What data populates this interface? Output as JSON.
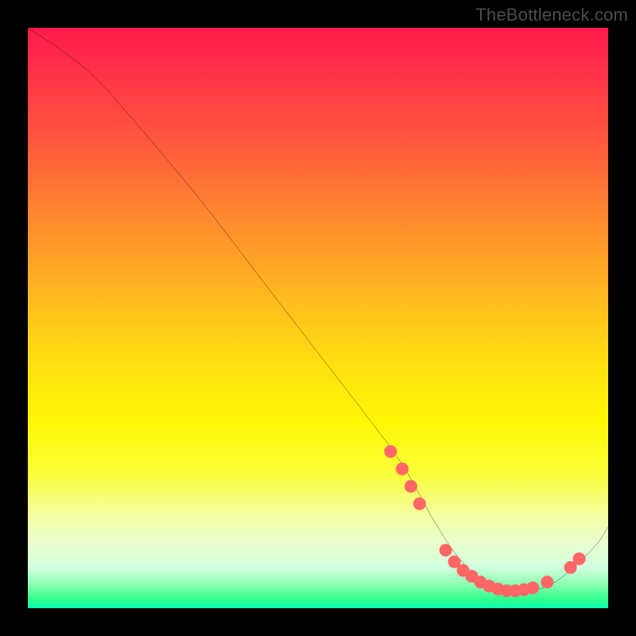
{
  "watermark": "TheBottleneck.com",
  "chart_data": {
    "type": "line",
    "title": "",
    "xlabel": "",
    "ylabel": "",
    "xlim": [
      0,
      100
    ],
    "ylim": [
      0,
      100
    ],
    "series": [
      {
        "name": "curve",
        "x": [
          0,
          6,
          12,
          20,
          30,
          40,
          50,
          60,
          65,
          70,
          74,
          78,
          82,
          86,
          90,
          94,
          98,
          100
        ],
        "y": [
          100,
          96,
          91,
          82,
          70,
          57,
          44,
          31,
          24,
          15,
          9,
          5,
          3,
          3,
          4,
          7,
          11,
          14
        ],
        "color": "#000000"
      }
    ],
    "markers": [
      {
        "x": 62.5,
        "y": 27
      },
      {
        "x": 64.5,
        "y": 24
      },
      {
        "x": 66.0,
        "y": 21
      },
      {
        "x": 67.5,
        "y": 18
      },
      {
        "x": 72.0,
        "y": 10
      },
      {
        "x": 73.5,
        "y": 8
      },
      {
        "x": 75.0,
        "y": 6.5
      },
      {
        "x": 76.5,
        "y": 5.5
      },
      {
        "x": 78.0,
        "y": 4.5
      },
      {
        "x": 79.5,
        "y": 3.8
      },
      {
        "x": 81.0,
        "y": 3.3
      },
      {
        "x": 82.5,
        "y": 3.0
      },
      {
        "x": 84.0,
        "y": 3.0
      },
      {
        "x": 85.5,
        "y": 3.2
      },
      {
        "x": 87.0,
        "y": 3.5
      },
      {
        "x": 89.5,
        "y": 4.5
      },
      {
        "x": 93.5,
        "y": 7.0
      },
      {
        "x": 95.0,
        "y": 8.5
      }
    ],
    "marker_color": "#ff6666",
    "background": "rainbow-vertical-gradient"
  }
}
